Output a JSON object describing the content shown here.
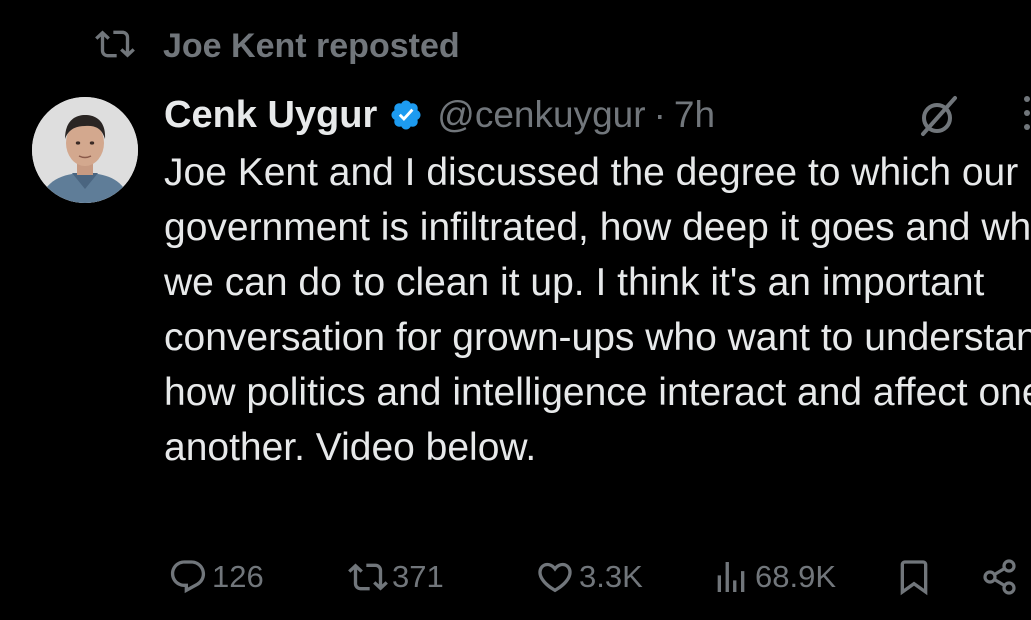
{
  "repost_banner": {
    "icon": "repost-icon",
    "label": "Joe Kent reposted"
  },
  "tweet": {
    "author_name": "Cenk Uygur",
    "verified_icon": "verified-badge-icon",
    "verified_color": "#1d9bf0",
    "handle": "@cenkuygur",
    "separator": "·",
    "time": "7h",
    "text": "Joe Kent and I discussed the degree to which our government is infiltrated, how deep it goes and what we can do to clean it up. I think it's an important conversation for grown-ups who want to understand how politics and intelligence interact and affect one another. Video below."
  },
  "actions": {
    "reply": {
      "icon": "reply-icon",
      "count": "126"
    },
    "repost": {
      "icon": "repost-icon",
      "count": "371"
    },
    "like": {
      "icon": "heart-icon",
      "count": "3.3K"
    },
    "views": {
      "icon": "views-icon",
      "count": "68.9K"
    },
    "bookmark": {
      "icon": "bookmark-icon"
    },
    "share": {
      "icon": "share-icon"
    }
  },
  "colors": {
    "background": "#000000",
    "primary_text": "#e7e9ea",
    "secondary_text": "#71767b"
  }
}
